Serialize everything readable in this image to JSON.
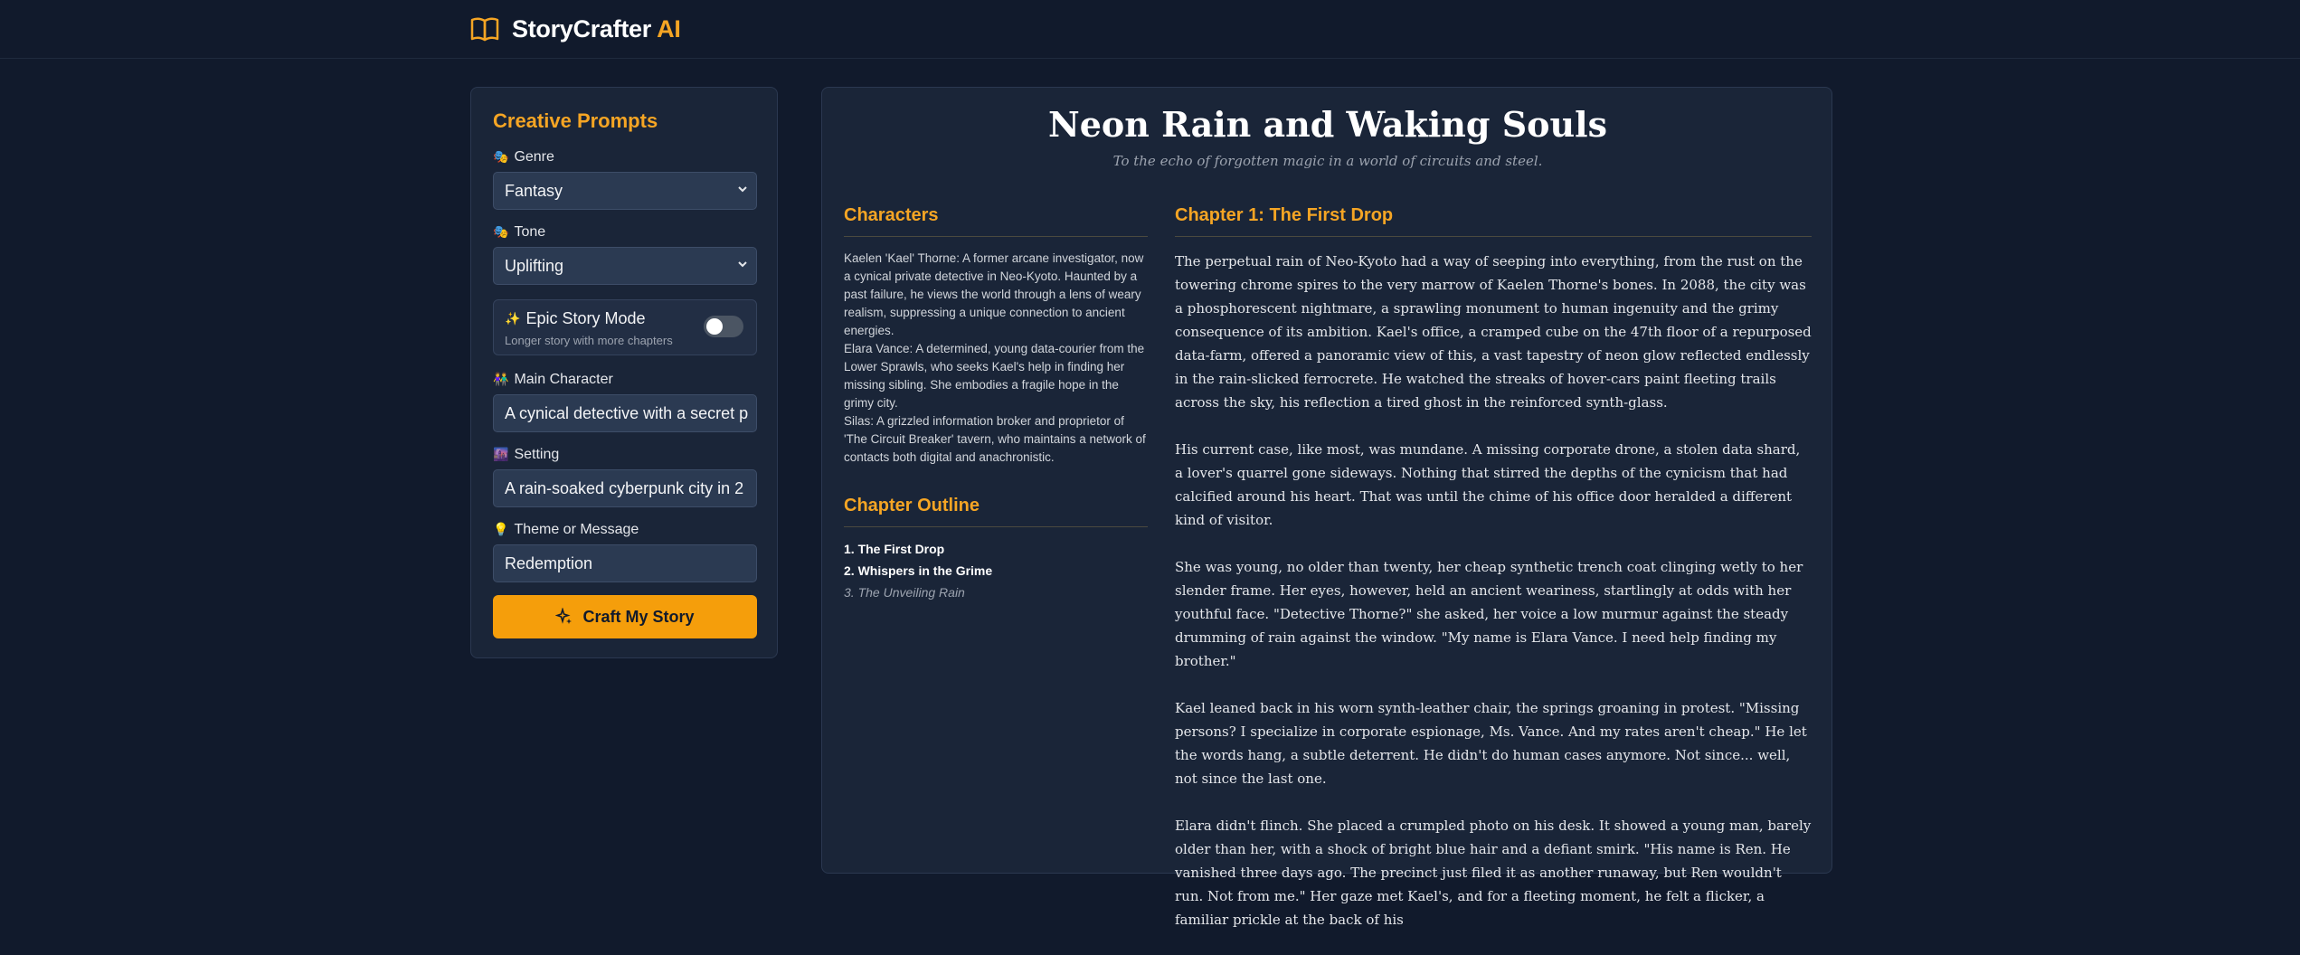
{
  "app": {
    "brand_main": "StoryCrafter",
    "brand_accent": " AI",
    "accent_color": "#f5a524"
  },
  "prompts": {
    "title": "Creative Prompts",
    "genre": {
      "label": "Genre",
      "icon": "theater-masks-icon",
      "value": "Fantasy"
    },
    "tone": {
      "label": "Tone",
      "icon": "performing-arts-icon",
      "value": "Uplifting"
    },
    "epic": {
      "title": "Epic Story Mode",
      "subtitle": "Longer story with more chapters",
      "enabled": false
    },
    "main_character": {
      "label": "Main Character",
      "value": "A cynical detective with a secret p"
    },
    "setting": {
      "label": "Setting",
      "value": "A rain-soaked cyberpunk city in 2"
    },
    "theme": {
      "label": "Theme or Message",
      "value": "Redemption"
    },
    "craft_label": "Craft My Story"
  },
  "story": {
    "title": "Neon Rain and Waking Souls",
    "subtitle": "To the echo of forgotten magic in a world of circuits and steel.",
    "characters_heading": "Characters",
    "characters": [
      "Kaelen 'Kael' Thorne: A former arcane investigator, now a cynical private detective in Neo-Kyoto. Haunted by a past failure, he views the world through a lens of weary realism, suppressing a unique connection to ancient energies.",
      "Elara Vance: A determined, young data-courier from the Lower Sprawls, who seeks Kael's help in finding her missing sibling. She embodies a fragile hope in the grimy city.",
      "Silas: A grizzled information broker and proprietor of 'The Circuit Breaker' tavern, who maintains a network of contacts both digital and anachronistic."
    ],
    "outline_heading": "Chapter Outline",
    "outline": [
      {
        "label": "1. The First Drop"
      },
      {
        "label": "2. Whispers in the Grime"
      },
      {
        "label": "3. The Unveiling Rain"
      }
    ],
    "chapter_heading": "Chapter 1: The First Drop",
    "paragraphs": [
      "The perpetual rain of Neo-Kyoto had a way of seeping into everything, from the rust on the towering chrome spires to the very marrow of Kaelen Thorne's bones. In 2088, the city was a phosphorescent nightmare, a sprawling monument to human ingenuity and the grimy consequence of its ambition. Kael's office, a cramped cube on the 47th floor of a repurposed data-farm, offered a panoramic view of this, a vast tapestry of neon glow reflected endlessly in the rain-slicked ferrocrete. He watched the streaks of hover-cars paint fleeting trails across the sky, his reflection a tired ghost in the reinforced synth-glass.",
      "His current case, like most, was mundane. A missing corporate drone, a stolen data shard, a lover's quarrel gone sideways. Nothing that stirred the depths of the cynicism that had calcified around his heart. That was until the chime of his office door heralded a different kind of visitor.",
      "She was young, no older than twenty, her cheap synthetic trench coat clinging wetly to her slender frame. Her eyes, however, held an ancient weariness, startlingly at odds with her youthful face. \"Detective Thorne?\" she asked, her voice a low murmur against the steady drumming of rain against the window. \"My name is Elara Vance. I need help finding my brother.\"",
      "Kael leaned back in his worn synth-leather chair, the springs groaning in protest. \"Missing persons? I specialize in corporate espionage, Ms. Vance. And my rates aren't cheap.\" He let the words hang, a subtle deterrent. He didn't do human cases anymore. Not since... well, not since the last one.",
      "Elara didn't flinch. She placed a crumpled photo on his desk. It showed a young man, barely older than her, with a shock of bright blue hair and a defiant smirk. \"His name is Ren. He vanished three days ago. The precinct just filed it as another runaway, but Ren wouldn't run. Not from me.\" Her gaze met Kael's, and for a fleeting moment, he felt a flicker, a familiar prickle at the back of his"
    ]
  }
}
